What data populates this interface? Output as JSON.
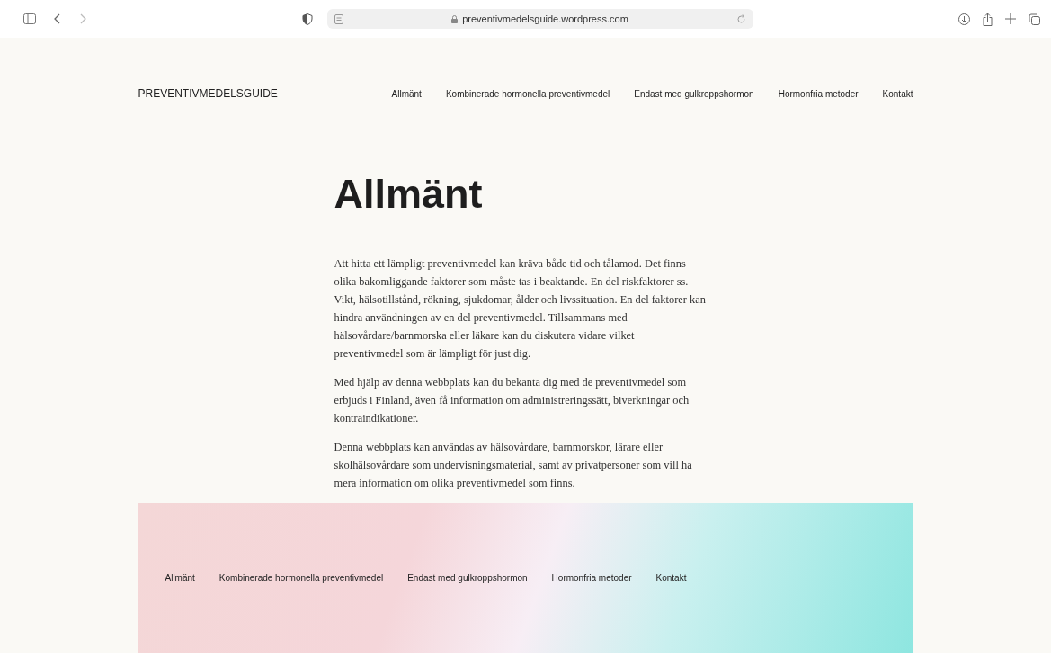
{
  "browser": {
    "url": "preventivmedelsguide.wordpress.com"
  },
  "header": {
    "site_title": "PREVENTIVMEDELSGUIDE",
    "nav": [
      {
        "label": "Allmänt"
      },
      {
        "label": "Kombinerade hormonella preventivmedel"
      },
      {
        "label": "Endast med gulkroppshormon"
      },
      {
        "label": "Hormonfria metoder"
      },
      {
        "label": "Kontakt"
      }
    ]
  },
  "page": {
    "title": "Allmänt",
    "paragraphs": [
      "Att hitta ett lämpligt preventivmedel kan kräva både tid och tålamod. Det finns olika bakomliggande faktorer som måste tas i beaktande. En del riskfaktorer ss. Vikt, hälsotillstånd, rökning, sjukdomar, ålder och livssituation. En del faktorer kan hindra användningen av en del preventivmedel. Tillsammans med hälsovårdare/barnmorska eller läkare kan du diskutera vidare vilket preventivmedel som är lämpligt för just dig.",
      "Med hjälp av denna webbplats kan du bekanta dig med de preventivmedel som erbjuds i Finland, även få information om administreringssätt, biverkningar och kontraindikationer.",
      "Denna webbplats kan användas av hälsovårdare, barnmorskor, lärare eller skolhälsovårdare som undervisningsmaterial, samt av privatpersoner som vill ha mera information om olika preventivmedel som finns."
    ]
  },
  "footer": {
    "nav": [
      {
        "label": "Allmänt"
      },
      {
        "label": "Kombinerade hormonella preventivmedel"
      },
      {
        "label": "Endast med gulkroppshormon"
      },
      {
        "label": "Hormonfria metoder"
      },
      {
        "label": "Kontakt"
      }
    ]
  }
}
